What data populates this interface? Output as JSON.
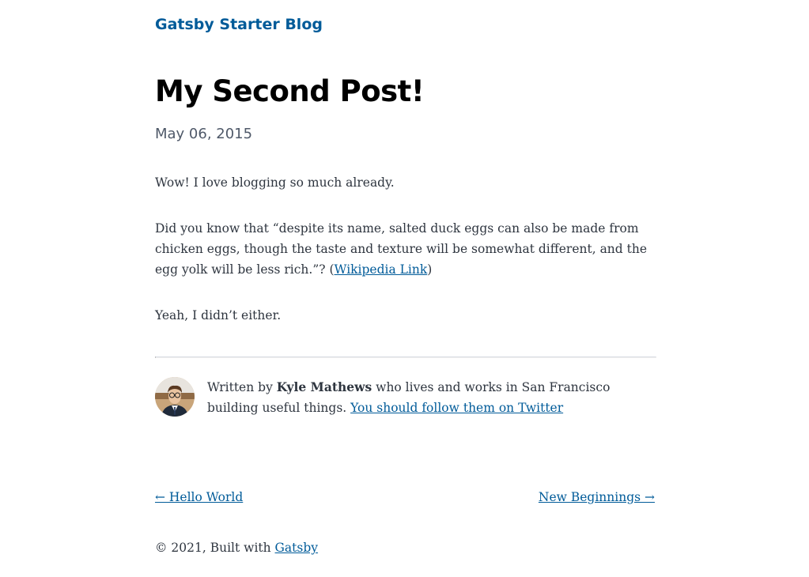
{
  "header": {
    "site_title": "Gatsby Starter Blog"
  },
  "post": {
    "title": "My Second Post!",
    "date": "May 06, 2015",
    "paragraph1": "Wow! I love blogging so much already.",
    "paragraph2_text": "Did you know that “despite its name, salted duck eggs can also be made from chicken eggs, though the taste and texture will be somewhat different, and the egg yolk will be less rich.”? (",
    "paragraph2_link": "Wikipedia Link",
    "paragraph2_end": ")",
    "paragraph3": "Yeah, I didn’t either."
  },
  "bio": {
    "prefix": "Written by ",
    "author": "Kyle Mathews",
    "middle": " who lives and works in San Francisco building useful things. ",
    "link": "You should follow them on Twitter"
  },
  "navigation": {
    "previous": "← Hello World",
    "next": "New Beginnings →"
  },
  "footer": {
    "copyright": "© 2021, Built with ",
    "link": "Gatsby"
  },
  "colors": {
    "link": "#005b99",
    "text": "#2e353f",
    "heading": "#000000"
  }
}
